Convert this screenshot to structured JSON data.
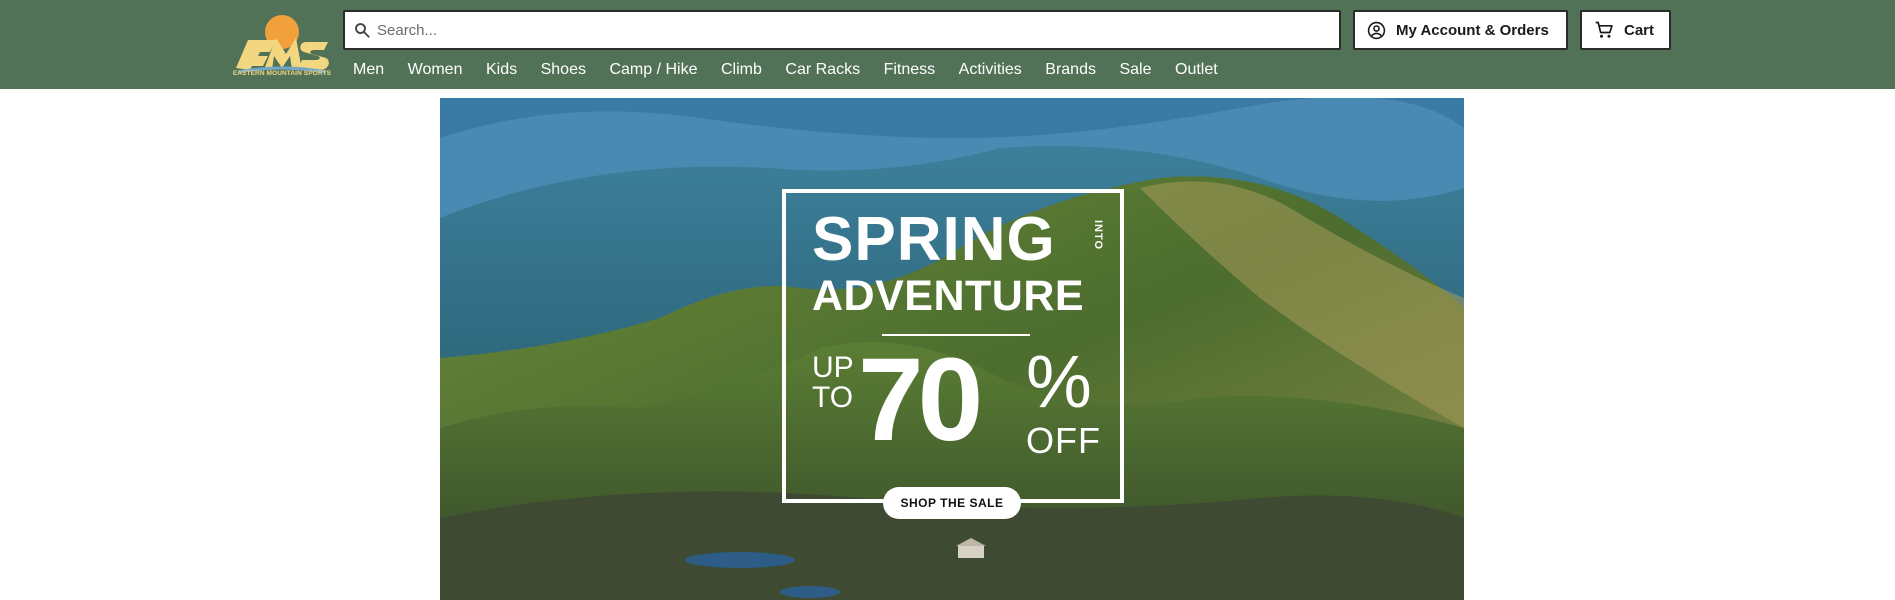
{
  "brand": {
    "logo_text": "EMS",
    "tagline": "EASTERN MOUNTAIN SPORTS",
    "colors": {
      "header_bg": "#527257",
      "logo_sun": "#f2a03c",
      "logo_text": "#f3d680"
    }
  },
  "search": {
    "placeholder": "Search...",
    "value": ""
  },
  "header": {
    "account_label": "My Account & Orders",
    "cart_label": "Cart"
  },
  "nav": {
    "items": [
      "Men",
      "Women",
      "Kids",
      "Shoes",
      "Camp / Hike",
      "Climb",
      "Car Racks",
      "Fitness",
      "Activities",
      "Brands",
      "Sale",
      "Outlet"
    ]
  },
  "hero": {
    "headline_line1": "SPRING",
    "headline_into": "INTO",
    "headline_line2": "ADVENTURE",
    "discount_up": "UP",
    "discount_to": "TO",
    "discount_value": "70",
    "discount_percent": "%",
    "discount_off": "OFF",
    "cta_label": "SHOP THE SALE"
  },
  "icons": [
    "search-icon",
    "account-icon",
    "cart-icon"
  ]
}
